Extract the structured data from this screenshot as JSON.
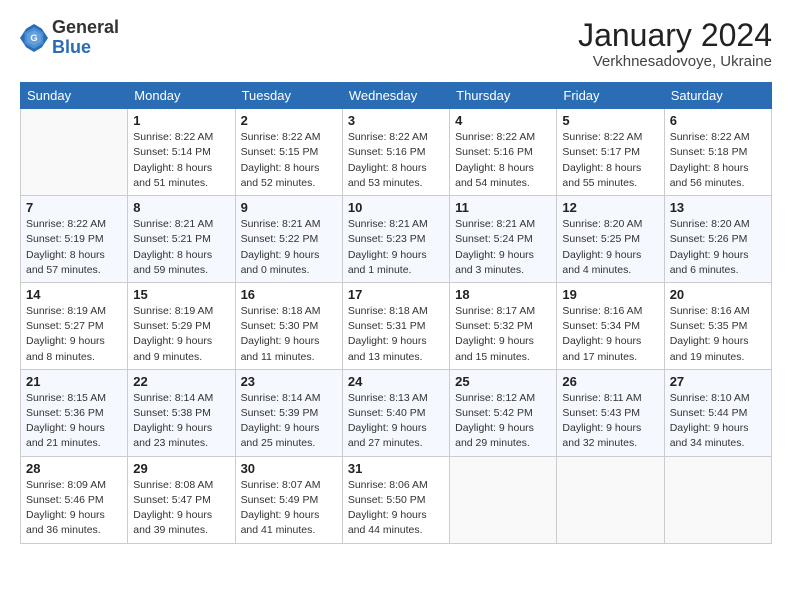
{
  "logo": {
    "general": "General",
    "blue": "Blue"
  },
  "header": {
    "title": "January 2024",
    "subtitle": "Verkhnesadovoye, Ukraine"
  },
  "weekdays": [
    "Sunday",
    "Monday",
    "Tuesday",
    "Wednesday",
    "Thursday",
    "Friday",
    "Saturday"
  ],
  "weeks": [
    [
      {
        "day": "",
        "info": ""
      },
      {
        "day": "1",
        "info": "Sunrise: 8:22 AM\nSunset: 5:14 PM\nDaylight: 8 hours\nand 51 minutes."
      },
      {
        "day": "2",
        "info": "Sunrise: 8:22 AM\nSunset: 5:15 PM\nDaylight: 8 hours\nand 52 minutes."
      },
      {
        "day": "3",
        "info": "Sunrise: 8:22 AM\nSunset: 5:16 PM\nDaylight: 8 hours\nand 53 minutes."
      },
      {
        "day": "4",
        "info": "Sunrise: 8:22 AM\nSunset: 5:16 PM\nDaylight: 8 hours\nand 54 minutes."
      },
      {
        "day": "5",
        "info": "Sunrise: 8:22 AM\nSunset: 5:17 PM\nDaylight: 8 hours\nand 55 minutes."
      },
      {
        "day": "6",
        "info": "Sunrise: 8:22 AM\nSunset: 5:18 PM\nDaylight: 8 hours\nand 56 minutes."
      }
    ],
    [
      {
        "day": "7",
        "info": "Sunrise: 8:22 AM\nSunset: 5:19 PM\nDaylight: 8 hours\nand 57 minutes."
      },
      {
        "day": "8",
        "info": "Sunrise: 8:21 AM\nSunset: 5:21 PM\nDaylight: 8 hours\nand 59 minutes."
      },
      {
        "day": "9",
        "info": "Sunrise: 8:21 AM\nSunset: 5:22 PM\nDaylight: 9 hours\nand 0 minutes."
      },
      {
        "day": "10",
        "info": "Sunrise: 8:21 AM\nSunset: 5:23 PM\nDaylight: 9 hours\nand 1 minute."
      },
      {
        "day": "11",
        "info": "Sunrise: 8:21 AM\nSunset: 5:24 PM\nDaylight: 9 hours\nand 3 minutes."
      },
      {
        "day": "12",
        "info": "Sunrise: 8:20 AM\nSunset: 5:25 PM\nDaylight: 9 hours\nand 4 minutes."
      },
      {
        "day": "13",
        "info": "Sunrise: 8:20 AM\nSunset: 5:26 PM\nDaylight: 9 hours\nand 6 minutes."
      }
    ],
    [
      {
        "day": "14",
        "info": "Sunrise: 8:19 AM\nSunset: 5:27 PM\nDaylight: 9 hours\nand 8 minutes."
      },
      {
        "day": "15",
        "info": "Sunrise: 8:19 AM\nSunset: 5:29 PM\nDaylight: 9 hours\nand 9 minutes."
      },
      {
        "day": "16",
        "info": "Sunrise: 8:18 AM\nSunset: 5:30 PM\nDaylight: 9 hours\nand 11 minutes."
      },
      {
        "day": "17",
        "info": "Sunrise: 8:18 AM\nSunset: 5:31 PM\nDaylight: 9 hours\nand 13 minutes."
      },
      {
        "day": "18",
        "info": "Sunrise: 8:17 AM\nSunset: 5:32 PM\nDaylight: 9 hours\nand 15 minutes."
      },
      {
        "day": "19",
        "info": "Sunrise: 8:16 AM\nSunset: 5:34 PM\nDaylight: 9 hours\nand 17 minutes."
      },
      {
        "day": "20",
        "info": "Sunrise: 8:16 AM\nSunset: 5:35 PM\nDaylight: 9 hours\nand 19 minutes."
      }
    ],
    [
      {
        "day": "21",
        "info": "Sunrise: 8:15 AM\nSunset: 5:36 PM\nDaylight: 9 hours\nand 21 minutes."
      },
      {
        "day": "22",
        "info": "Sunrise: 8:14 AM\nSunset: 5:38 PM\nDaylight: 9 hours\nand 23 minutes."
      },
      {
        "day": "23",
        "info": "Sunrise: 8:14 AM\nSunset: 5:39 PM\nDaylight: 9 hours\nand 25 minutes."
      },
      {
        "day": "24",
        "info": "Sunrise: 8:13 AM\nSunset: 5:40 PM\nDaylight: 9 hours\nand 27 minutes."
      },
      {
        "day": "25",
        "info": "Sunrise: 8:12 AM\nSunset: 5:42 PM\nDaylight: 9 hours\nand 29 minutes."
      },
      {
        "day": "26",
        "info": "Sunrise: 8:11 AM\nSunset: 5:43 PM\nDaylight: 9 hours\nand 32 minutes."
      },
      {
        "day": "27",
        "info": "Sunrise: 8:10 AM\nSunset: 5:44 PM\nDaylight: 9 hours\nand 34 minutes."
      }
    ],
    [
      {
        "day": "28",
        "info": "Sunrise: 8:09 AM\nSunset: 5:46 PM\nDaylight: 9 hours\nand 36 minutes."
      },
      {
        "day": "29",
        "info": "Sunrise: 8:08 AM\nSunset: 5:47 PM\nDaylight: 9 hours\nand 39 minutes."
      },
      {
        "day": "30",
        "info": "Sunrise: 8:07 AM\nSunset: 5:49 PM\nDaylight: 9 hours\nand 41 minutes."
      },
      {
        "day": "31",
        "info": "Sunrise: 8:06 AM\nSunset: 5:50 PM\nDaylight: 9 hours\nand 44 minutes."
      },
      {
        "day": "",
        "info": ""
      },
      {
        "day": "",
        "info": ""
      },
      {
        "day": "",
        "info": ""
      }
    ]
  ]
}
